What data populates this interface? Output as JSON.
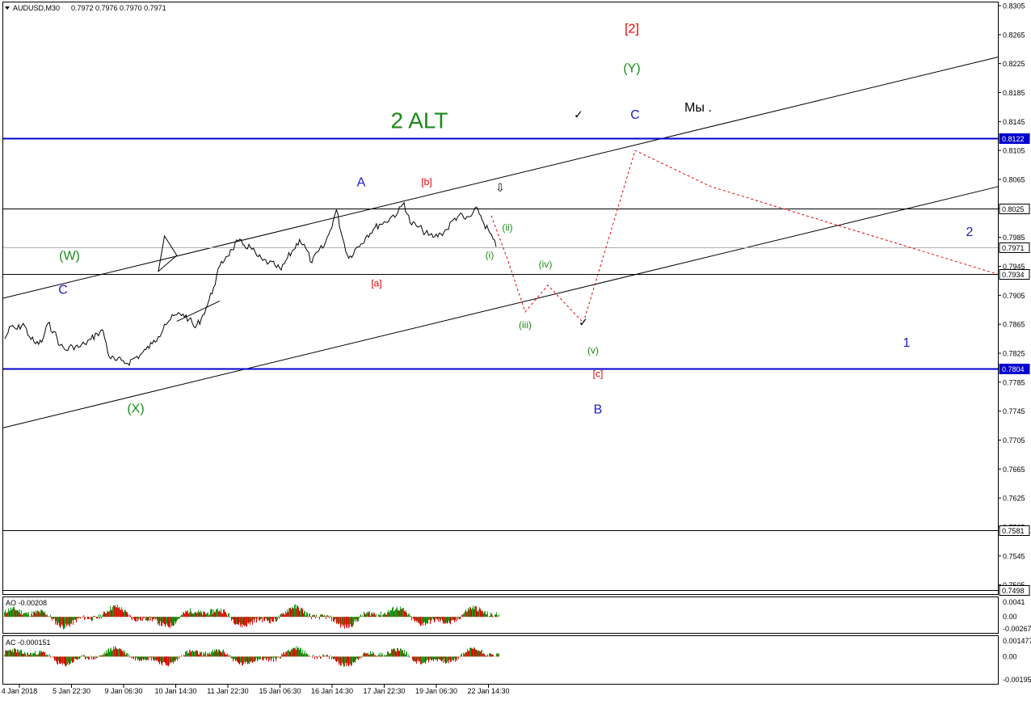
{
  "header": {
    "symbol": "AUDUSD,M30",
    "ohlc": "0.7972 0.7976 0.7970 0.7971",
    "ao_label": "AO -0.00208",
    "ac_label": "AC -0.000151"
  },
  "colors": {
    "background": "#ffffff",
    "price_line": "#000000",
    "blue_level": "#0000cc",
    "forecast": "#e60000",
    "wave_green": "#1a8a1a",
    "wave_blue": "#1a1acc",
    "wave_red": "#e60000",
    "osc_up": "#1a9a1a",
    "osc_down": "#e60000"
  },
  "chart_data": [
    {
      "type": "line",
      "title": "AUDUSD,M30",
      "ylim": [
        0.7499,
        0.8305
      ],
      "y_ticks": [
        "0.8305",
        "0.8265",
        "0.8225",
        "0.8185",
        "0.8145",
        "0.8105",
        "0.8065",
        "0.8025",
        "0.7985",
        "0.7945",
        "0.7905",
        "0.7865",
        "0.7825",
        "0.7785",
        "0.7745",
        "0.7705",
        "0.7665",
        "0.7625",
        "0.7585",
        "0.7545",
        "0.7505"
      ],
      "x_ticks": [
        "4 Jan 2018",
        "5 Jan 22:30",
        "9 Jan 06:30",
        "10 Jan 14:30",
        "11 Jan 22:30",
        "15 Jan 06:30",
        "16 Jan 14:30",
        "17 Jan 22:30",
        "19 Jan 06:30",
        "22 Jan 14:30"
      ],
      "price_path": [
        0.7845,
        0.7862,
        0.7858,
        0.7866,
        0.7848,
        0.7838,
        0.784,
        0.7866,
        0.7855,
        0.7836,
        0.7829,
        0.7835,
        0.7833,
        0.7838,
        0.7844,
        0.7852,
        0.7856,
        0.782,
        0.7815,
        0.7815,
        0.7811,
        0.7818,
        0.7822,
        0.783,
        0.7838,
        0.7848,
        0.7865,
        0.7872,
        0.7878,
        0.7879,
        0.7872,
        0.786,
        0.7873,
        0.7892,
        0.7916,
        0.7945,
        0.7958,
        0.7968,
        0.798,
        0.7974,
        0.7971,
        0.796,
        0.7953,
        0.795,
        0.7946,
        0.794,
        0.7956,
        0.7968,
        0.7982,
        0.797,
        0.795,
        0.7965,
        0.7973,
        0.7995,
        0.8023,
        0.7984,
        0.7956,
        0.7968,
        0.7976,
        0.7988,
        0.7996,
        0.8003,
        0.8006,
        0.8014,
        0.8019,
        0.8033,
        0.8005,
        0.8001,
        0.7995,
        0.7988,
        0.7986,
        0.799,
        0.7996,
        0.8009,
        0.8016,
        0.801,
        0.8015,
        0.8025,
        0.8004,
        0.7991,
        0.7972
      ],
      "forecast_path": [
        0.8015,
        0.7955,
        0.7882,
        0.7919,
        0.7867,
        0.8105,
        0.8055,
        0.7934
      ],
      "levels": [
        {
          "value": 0.8122,
          "label": "0.8122",
          "style": "blue"
        },
        {
          "value": 0.8025,
          "label": "0.8025",
          "style": "black"
        },
        {
          "value": 0.7971,
          "label": "0.7971",
          "style": "gray"
        },
        {
          "value": 0.7934,
          "label": "0.7934",
          "style": "black"
        },
        {
          "value": 0.7804,
          "label": "0.7804",
          "style": "blue"
        },
        {
          "value": 0.7581,
          "label": "0.7581",
          "style": "black"
        },
        {
          "value": 0.7498,
          "label": "0.7498",
          "style": "black"
        }
      ],
      "channel_lines": [
        {
          "from": 0.7901,
          "to": 0.8234
        },
        {
          "from": 0.7722,
          "to": 0.8055
        }
      ],
      "wave_labels": [
        {
          "text": "2 ALT",
          "color": "green",
          "size": "xl",
          "price": 0.8147,
          "bar": 34
        },
        {
          "text": "[2]",
          "color": "red",
          "size": "lg",
          "price": 0.8274,
          "bar": 52
        },
        {
          "text": "(Y)",
          "color": "green",
          "size": "lg",
          "price": 0.8219,
          "bar": 52
        },
        {
          "text": "C",
          "color": "blue",
          "size": "lg",
          "price": 0.8155,
          "bar": 52
        },
        {
          "text": "Мы .",
          "color": "black",
          "size": "lg",
          "price": 0.8165,
          "bar": 57
        },
        {
          "text": "A",
          "color": "blue",
          "size": "lg",
          "price": 0.8062,
          "bar": 29
        },
        {
          "text": "[b]",
          "color": "red",
          "size": "sm",
          "price": 0.8062,
          "bar": 35
        },
        {
          "text": "(ii)",
          "color": "green",
          "size": "sm",
          "price": 0.7999,
          "bar": 42
        },
        {
          "text": "(i)",
          "color": "green",
          "size": "sm",
          "price": 0.7961,
          "bar": 40
        },
        {
          "text": "(W)",
          "color": "green",
          "size": "lg",
          "price": 0.796,
          "bar": 5
        },
        {
          "text": "C",
          "color": "blue",
          "size": "lg",
          "price": 0.7913,
          "bar": 5
        },
        {
          "text": "[a]",
          "color": "red",
          "size": "sm",
          "price": 0.7922,
          "bar": 31
        },
        {
          "text": "(iv)",
          "color": "green",
          "size": "sm",
          "price": 0.7948,
          "bar": 45
        },
        {
          "text": "(iii)",
          "color": "green",
          "size": "sm",
          "price": 0.7864,
          "bar": 43
        },
        {
          "text": "(v)",
          "color": "green",
          "size": "sm",
          "price": 0.7829,
          "bar": 49
        },
        {
          "text": "[c]",
          "color": "red",
          "size": "sm",
          "price": 0.7797,
          "bar": 49
        },
        {
          "text": "B",
          "color": "blue",
          "size": "lg",
          "price": 0.7748,
          "bar": 49
        },
        {
          "text": "(X)",
          "color": "green",
          "size": "lg",
          "price": 0.7749,
          "bar": 11
        },
        {
          "text": "2",
          "color": "blue",
          "size": "lg",
          "price": 0.7993,
          "bar": 80
        },
        {
          "text": "1",
          "color": "blue",
          "size": "lg",
          "price": 0.784,
          "bar": 75
        }
      ],
      "check_marks": [
        {
          "text": "✓",
          "price": 0.8155,
          "bar": 47
        },
        {
          "text": "✓",
          "price": 0.7868,
          "bar": 48
        }
      ],
      "arrow_mark": {
        "text": "⇩",
        "price": 0.8055,
        "bar": 41
      }
    },
    {
      "type": "bar",
      "title": "AO -0.00208",
      "y_ticks": [
        "0.0041",
        "0.00",
        "-0.00267"
      ],
      "ylim": [
        -0.00267,
        0.0041
      ]
    },
    {
      "type": "bar",
      "title": "AC -0.000151",
      "y_ticks": [
        "0.001477",
        "0.00",
        "-0.00195"
      ],
      "ylim": [
        -0.00195,
        0.001477
      ]
    }
  ]
}
